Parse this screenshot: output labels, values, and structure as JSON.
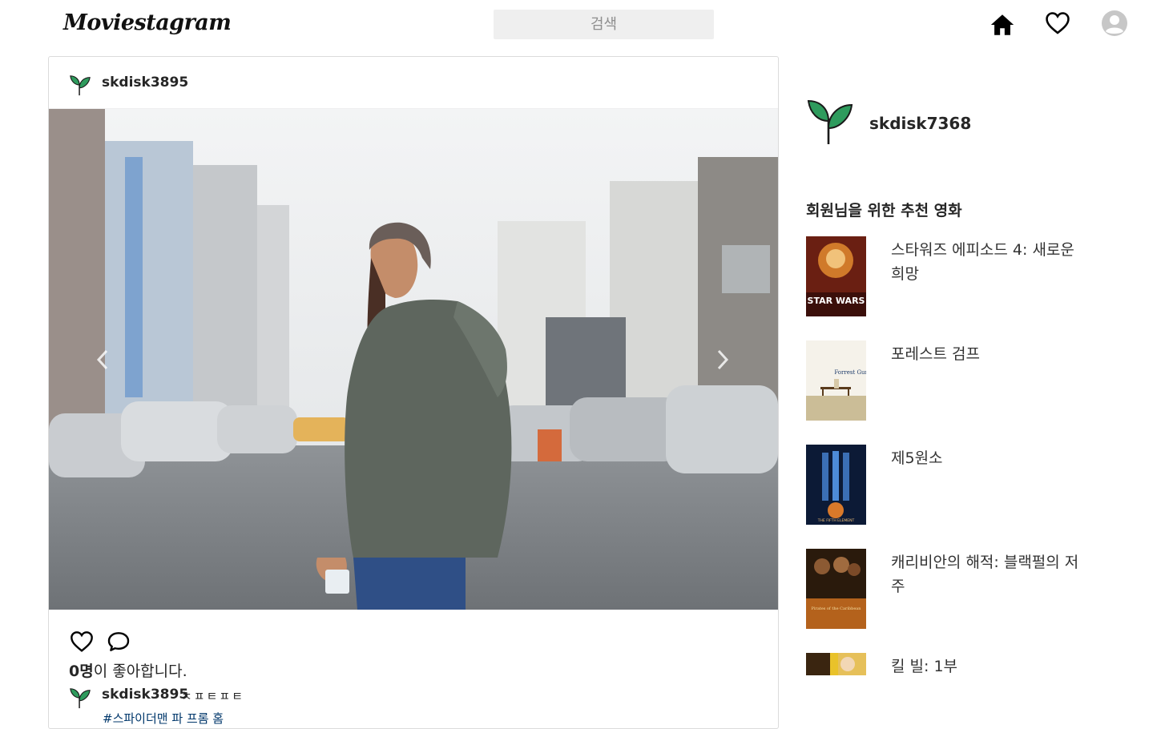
{
  "header": {
    "logo": "Moviestagram",
    "search_placeholder": "검색",
    "icons": [
      "home-icon",
      "heart-icon",
      "profile-icon"
    ]
  },
  "post": {
    "username": "skdisk3895",
    "likes_count": "0명",
    "likes_suffix": "이 좋아합니다.",
    "caption_user": "skdisk3895",
    "caption_text": "ㅊㅍㅌㅍㅌ",
    "hashtag": "#스파이더맨 파 프롬 홈"
  },
  "sidebar": {
    "username": "skdisk7368",
    "rec_title": "회원님을 위한 추천 영화",
    "movies": [
      {
        "title": "스타워즈 에피소드 4: 새로운 희망",
        "poster_text": "STAR WARS"
      },
      {
        "title": "포레스트 검프",
        "poster_text": "Forrest Gump"
      },
      {
        "title": "제5원소",
        "poster_text": "THE FIFTH ELEMENT"
      },
      {
        "title": "캐리비안의 해적: 블랙펄의 저주",
        "poster_text": "Pirates of the Caribbean"
      },
      {
        "title": "킬 빌: 1부",
        "poster_text": ""
      }
    ]
  },
  "colors": {
    "border": "#dbdbdb",
    "search_bg": "#efefef",
    "text": "#262626",
    "leaf_green": "#2e9b5d"
  }
}
